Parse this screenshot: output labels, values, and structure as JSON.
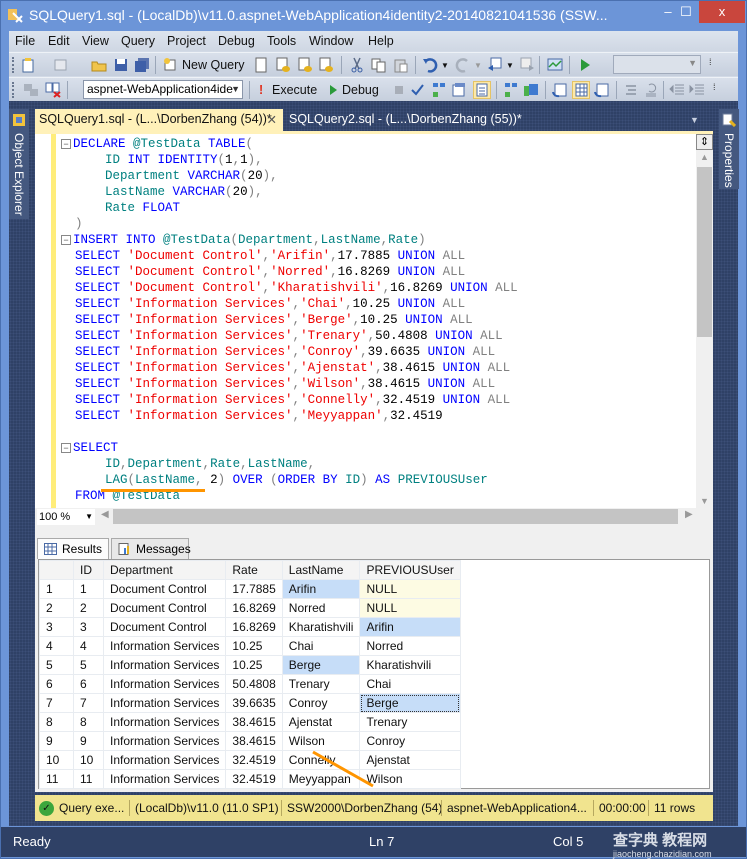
{
  "window": {
    "title": "SQLQuery1.sql - (LocalDb)\\v11.0.aspnet-WebApplication4identity2-20140821041536 (SSW...",
    "minimize_glyph": "–",
    "maximize_glyph": "☐",
    "close_glyph": "x"
  },
  "menu": [
    "File",
    "Edit",
    "View",
    "Query",
    "Project",
    "Debug",
    "Tools",
    "Window",
    "Help"
  ],
  "toolbar1": {
    "new_query_label": "New Query"
  },
  "toolbar2": {
    "database_select": "aspnet-WebApplication4ide",
    "execute_label": "Execute",
    "debug_label": "Debug"
  },
  "side_panels": {
    "left": "Object Explorer",
    "right": "Properties"
  },
  "doc_tabs": [
    {
      "label": "SQLQuery1.sql - (L...\\DorbenZhang (54))*",
      "active": true
    },
    {
      "label": "SQLQuery2.sql - (L...\\DorbenZhang (55))*",
      "active": false
    }
  ],
  "code_lines": [
    [
      {
        "t": "DECLARE ",
        "c": "kw"
      },
      {
        "t": "@TestData ",
        "c": "id"
      },
      {
        "t": "TABLE",
        "c": "kw"
      },
      {
        "t": "(",
        "c": "gray"
      }
    ],
    [
      {
        "t": "    ID ",
        "c": "id"
      },
      {
        "t": "INT IDENTITY",
        "c": "kw"
      },
      {
        "t": "(",
        "c": "gray"
      },
      {
        "t": "1",
        "c": "blk"
      },
      {
        "t": ",",
        "c": "gray"
      },
      {
        "t": "1",
        "c": "blk"
      },
      {
        "t": "),",
        "c": "gray"
      }
    ],
    [
      {
        "t": "    Department ",
        "c": "id"
      },
      {
        "t": "VARCHAR",
        "c": "kw"
      },
      {
        "t": "(",
        "c": "gray"
      },
      {
        "t": "20",
        "c": "blk"
      },
      {
        "t": "),",
        "c": "gray"
      }
    ],
    [
      {
        "t": "    LastName ",
        "c": "id"
      },
      {
        "t": "VARCHAR",
        "c": "kw"
      },
      {
        "t": "(",
        "c": "gray"
      },
      {
        "t": "20",
        "c": "blk"
      },
      {
        "t": "),",
        "c": "gray"
      }
    ],
    [
      {
        "t": "    Rate ",
        "c": "id"
      },
      {
        "t": "FLOAT",
        "c": "kw"
      }
    ],
    [
      {
        "t": ")",
        "c": "gray"
      }
    ],
    [
      {
        "t": "INSERT INTO ",
        "c": "kw"
      },
      {
        "t": "@TestData",
        "c": "id"
      },
      {
        "t": "(",
        "c": "gray"
      },
      {
        "t": "Department",
        "c": "id"
      },
      {
        "t": ",",
        "c": "gray"
      },
      {
        "t": "LastName",
        "c": "id"
      },
      {
        "t": ",",
        "c": "gray"
      },
      {
        "t": "Rate",
        "c": "id"
      },
      {
        "t": ")",
        "c": "gray"
      }
    ],
    [
      {
        "t": "SELECT ",
        "c": "kw"
      },
      {
        "t": "'Document Control'",
        "c": "str"
      },
      {
        "t": ",",
        "c": "gray"
      },
      {
        "t": "'Arifin'",
        "c": "str"
      },
      {
        "t": ",",
        "c": "gray"
      },
      {
        "t": "17.7885 ",
        "c": "blk"
      },
      {
        "t": "UNION ",
        "c": "kw"
      },
      {
        "t": "ALL",
        "c": "gray"
      }
    ],
    [
      {
        "t": "SELECT ",
        "c": "kw"
      },
      {
        "t": "'Document Control'",
        "c": "str"
      },
      {
        "t": ",",
        "c": "gray"
      },
      {
        "t": "'Norred'",
        "c": "str"
      },
      {
        "t": ",",
        "c": "gray"
      },
      {
        "t": "16.8269 ",
        "c": "blk"
      },
      {
        "t": "UNION ",
        "c": "kw"
      },
      {
        "t": "ALL",
        "c": "gray"
      }
    ],
    [
      {
        "t": "SELECT ",
        "c": "kw"
      },
      {
        "t": "'Document Control'",
        "c": "str"
      },
      {
        "t": ",",
        "c": "gray"
      },
      {
        "t": "'Kharatishvili'",
        "c": "str"
      },
      {
        "t": ",",
        "c": "gray"
      },
      {
        "t": "16.8269 ",
        "c": "blk"
      },
      {
        "t": "UNION ",
        "c": "kw"
      },
      {
        "t": "ALL",
        "c": "gray"
      }
    ],
    [
      {
        "t": "SELECT ",
        "c": "kw"
      },
      {
        "t": "'Information Services'",
        "c": "str"
      },
      {
        "t": ",",
        "c": "gray"
      },
      {
        "t": "'Chai'",
        "c": "str"
      },
      {
        "t": ",",
        "c": "gray"
      },
      {
        "t": "10.25 ",
        "c": "blk"
      },
      {
        "t": "UNION ",
        "c": "kw"
      },
      {
        "t": "ALL",
        "c": "gray"
      }
    ],
    [
      {
        "t": "SELECT ",
        "c": "kw"
      },
      {
        "t": "'Information Services'",
        "c": "str"
      },
      {
        "t": ",",
        "c": "gray"
      },
      {
        "t": "'Berge'",
        "c": "str"
      },
      {
        "t": ",",
        "c": "gray"
      },
      {
        "t": "10.25 ",
        "c": "blk"
      },
      {
        "t": "UNION ",
        "c": "kw"
      },
      {
        "t": "ALL",
        "c": "gray"
      }
    ],
    [
      {
        "t": "SELECT ",
        "c": "kw"
      },
      {
        "t": "'Information Services'",
        "c": "str"
      },
      {
        "t": ",",
        "c": "gray"
      },
      {
        "t": "'Trenary'",
        "c": "str"
      },
      {
        "t": ",",
        "c": "gray"
      },
      {
        "t": "50.4808 ",
        "c": "blk"
      },
      {
        "t": "UNION ",
        "c": "kw"
      },
      {
        "t": "ALL",
        "c": "gray"
      }
    ],
    [
      {
        "t": "SELECT ",
        "c": "kw"
      },
      {
        "t": "'Information Services'",
        "c": "str"
      },
      {
        "t": ",",
        "c": "gray"
      },
      {
        "t": "'Conroy'",
        "c": "str"
      },
      {
        "t": ",",
        "c": "gray"
      },
      {
        "t": "39.6635 ",
        "c": "blk"
      },
      {
        "t": "UNION ",
        "c": "kw"
      },
      {
        "t": "ALL",
        "c": "gray"
      }
    ],
    [
      {
        "t": "SELECT ",
        "c": "kw"
      },
      {
        "t": "'Information Services'",
        "c": "str"
      },
      {
        "t": ",",
        "c": "gray"
      },
      {
        "t": "'Ajenstat'",
        "c": "str"
      },
      {
        "t": ",",
        "c": "gray"
      },
      {
        "t": "38.4615 ",
        "c": "blk"
      },
      {
        "t": "UNION ",
        "c": "kw"
      },
      {
        "t": "ALL",
        "c": "gray"
      }
    ],
    [
      {
        "t": "SELECT ",
        "c": "kw"
      },
      {
        "t": "'Information Services'",
        "c": "str"
      },
      {
        "t": ",",
        "c": "gray"
      },
      {
        "t": "'Wilson'",
        "c": "str"
      },
      {
        "t": ",",
        "c": "gray"
      },
      {
        "t": "38.4615 ",
        "c": "blk"
      },
      {
        "t": "UNION ",
        "c": "kw"
      },
      {
        "t": "ALL",
        "c": "gray"
      }
    ],
    [
      {
        "t": "SELECT ",
        "c": "kw"
      },
      {
        "t": "'Information Services'",
        "c": "str"
      },
      {
        "t": ",",
        "c": "gray"
      },
      {
        "t": "'Connelly'",
        "c": "str"
      },
      {
        "t": ",",
        "c": "gray"
      },
      {
        "t": "32.4519 ",
        "c": "blk"
      },
      {
        "t": "UNION ",
        "c": "kw"
      },
      {
        "t": "ALL",
        "c": "gray"
      }
    ],
    [
      {
        "t": "SELECT ",
        "c": "kw"
      },
      {
        "t": "'Information Services'",
        "c": "str"
      },
      {
        "t": ",",
        "c": "gray"
      },
      {
        "t": "'Meyyappan'",
        "c": "str"
      },
      {
        "t": ",",
        "c": "gray"
      },
      {
        "t": "32.4519",
        "c": "blk"
      }
    ],
    [],
    [
      {
        "t": "SELECT",
        "c": "kw"
      }
    ],
    [
      {
        "t": "    ID",
        "c": "id"
      },
      {
        "t": ",",
        "c": "gray"
      },
      {
        "t": "Department",
        "c": "id"
      },
      {
        "t": ",",
        "c": "gray"
      },
      {
        "t": "Rate",
        "c": "id"
      },
      {
        "t": ",",
        "c": "gray"
      },
      {
        "t": "LastName",
        "c": "id"
      },
      {
        "t": ",",
        "c": "gray"
      }
    ],
    [
      {
        "t": "    LAG",
        "c": "id"
      },
      {
        "t": "(",
        "c": "gray"
      },
      {
        "t": "LastName",
        "c": "id"
      },
      {
        "t": ",",
        "c": "gray"
      },
      {
        "t": " 2",
        "c": "blk"
      },
      {
        "t": ") ",
        "c": "gray"
      },
      {
        "t": "OVER ",
        "c": "kw"
      },
      {
        "t": "(",
        "c": "gray"
      },
      {
        "t": "ORDER BY ",
        "c": "kw"
      },
      {
        "t": "ID",
        "c": "id"
      },
      {
        "t": ") ",
        "c": "gray"
      },
      {
        "t": "AS ",
        "c": "kw"
      },
      {
        "t": "PREVIOUSUser",
        "c": "id"
      }
    ],
    [
      {
        "t": "FROM ",
        "c": "kw"
      },
      {
        "t": "@TestData",
        "c": "id"
      }
    ]
  ],
  "fold_lines": [
    0,
    6,
    19
  ],
  "zoom_level": "100 %",
  "results_tabs": [
    "Results",
    "Messages"
  ],
  "grid": {
    "columns": [
      "",
      "ID",
      "Department",
      "Rate",
      "LastName",
      "PREVIOUSUser"
    ],
    "rows": [
      [
        "1",
        "1",
        "Document Control",
        "17.7885",
        "Arifin",
        "NULL"
      ],
      [
        "2",
        "2",
        "Document Control",
        "16.8269",
        "Norred",
        "NULL"
      ],
      [
        "3",
        "3",
        "Document Control",
        "16.8269",
        "Kharatishvili",
        "Arifin"
      ],
      [
        "4",
        "4",
        "Information Services",
        "10.25",
        "Chai",
        "Norred"
      ],
      [
        "5",
        "5",
        "Information Services",
        "10.25",
        "Berge",
        "Kharatishvili"
      ],
      [
        "6",
        "6",
        "Information Services",
        "50.4808",
        "Trenary",
        "Chai"
      ],
      [
        "7",
        "7",
        "Information Services",
        "39.6635",
        "Conroy",
        "Berge"
      ],
      [
        "8",
        "8",
        "Information Services",
        "38.4615",
        "Ajenstat",
        "Trenary"
      ],
      [
        "9",
        "9",
        "Information Services",
        "38.4615",
        "Wilson",
        "Conroy"
      ],
      [
        "10",
        "10",
        "Information Services",
        "32.4519",
        "Connelly",
        "Ajenstat"
      ],
      [
        "11",
        "11",
        "Information Services",
        "32.4519",
        "Meyyappan",
        "Wilson"
      ]
    ]
  },
  "exec_bar": {
    "status": "Query exe...",
    "server": "(LocalDb)\\v11.0 (11.0 SP1)",
    "user": "SSW2000\\DorbenZhang (54)",
    "database": "aspnet-WebApplication4...",
    "elapsed": "00:00:00",
    "rows": "11 rows"
  },
  "statusbar": {
    "state": "Ready",
    "line": "Ln 7",
    "col": "Col 5"
  },
  "watermark": {
    "main": "查字典 教程网",
    "sub": "jiaocheng.chazidian.com"
  },
  "colors": {
    "annotation": "#ff9500",
    "active_tab": "#fff1b9",
    "selection": "#c6ddf8"
  }
}
